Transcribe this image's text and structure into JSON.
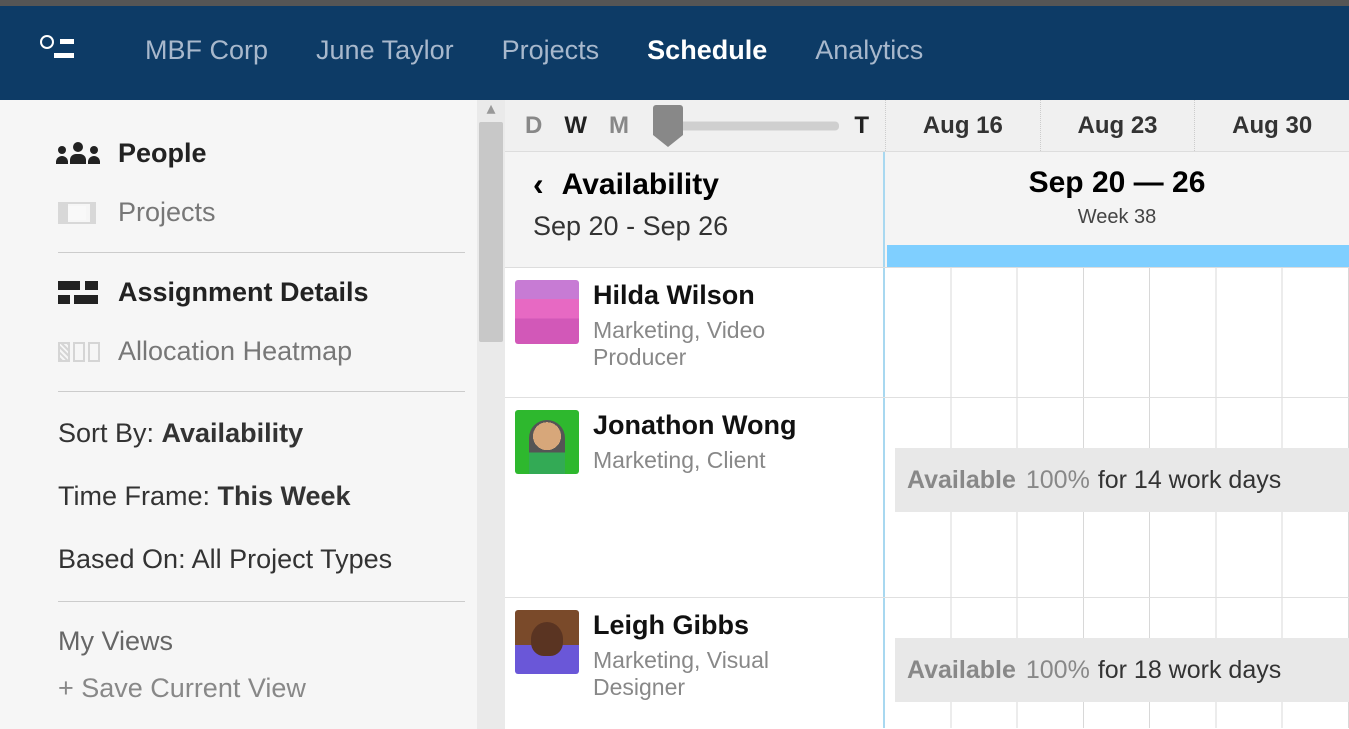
{
  "nav": {
    "items": [
      "MBF Corp",
      "June Taylor",
      "Projects",
      "Schedule",
      "Analytics"
    ],
    "active_index": 3
  },
  "sidebar": {
    "people": "People",
    "projects": "Projects",
    "assignment_details": "Assignment Details",
    "allocation_heatmap": "Allocation Heatmap",
    "sort_by_label": "Sort By: ",
    "sort_by_value": "Availability",
    "time_frame_label": "Time Frame: ",
    "time_frame_value": "This Week",
    "based_on_label": "Based On: ",
    "based_on_value": "All Project Types",
    "my_views": "My Views",
    "save_view": "+ Save Current View"
  },
  "timeline": {
    "zoom_options": [
      "D",
      "W",
      "M"
    ],
    "zoom_active": "W",
    "today_letter": "T",
    "columns": [
      "Aug 16",
      "Aug 23",
      "Aug 30"
    ]
  },
  "availability_header": {
    "title": "Availability",
    "range": "Sep 20 - Sep 26",
    "week_title": "Sep 20 — 26",
    "week_sub": "Week 38"
  },
  "people": [
    {
      "name": "Hilda Wilson",
      "role": "Marketing, Video Producer",
      "availability": null
    },
    {
      "name": "Jonathon Wong",
      "role": "Marketing, Client",
      "availability": {
        "label": "Available",
        "percent": "100%",
        "rest": "for 14 work days"
      }
    },
    {
      "name": "Leigh Gibbs",
      "role": "Marketing, Visual Designer",
      "availability": {
        "label": "Available",
        "percent": "100%",
        "rest": "for 18 work days"
      }
    }
  ]
}
